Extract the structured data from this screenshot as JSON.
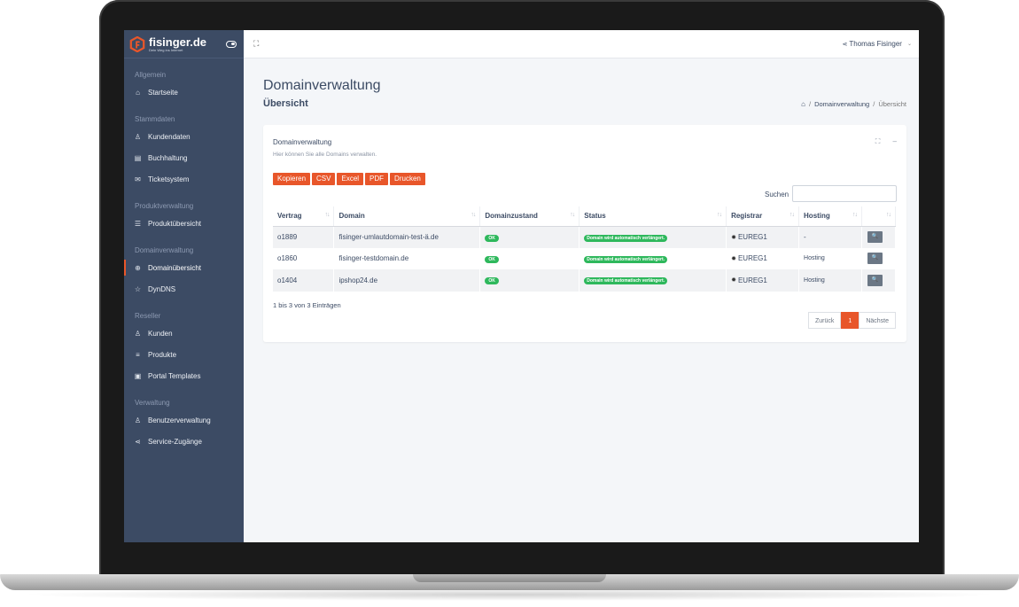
{
  "brand": {
    "name": "fisinger.de",
    "tagline": "Dein Weg ins Internet"
  },
  "sidebar": {
    "sections": [
      {
        "title": "Allgemein",
        "items": [
          {
            "label": "Startseite",
            "icon": "home-icon"
          }
        ]
      },
      {
        "title": "Stammdaten",
        "items": [
          {
            "label": "Kundendaten",
            "icon": "user-icon"
          },
          {
            "label": "Buchhaltung",
            "icon": "document-icon"
          },
          {
            "label": "Ticketsystem",
            "icon": "mail-icon"
          }
        ]
      },
      {
        "title": "Produktverwaltung",
        "items": [
          {
            "label": "Produktübersicht",
            "icon": "server-icon"
          }
        ]
      },
      {
        "title": "Domainverwaltung",
        "items": [
          {
            "label": "Domainübersicht",
            "icon": "globe-icon",
            "active": true
          },
          {
            "label": "DynDNS",
            "icon": "star-icon"
          }
        ]
      },
      {
        "title": "Reseller",
        "items": [
          {
            "label": "Kunden",
            "icon": "user-icon"
          },
          {
            "label": "Produkte",
            "icon": "list-icon"
          },
          {
            "label": "Portal Templates",
            "icon": "window-icon"
          }
        ]
      },
      {
        "title": "Verwaltung",
        "items": [
          {
            "label": "Benutzerverwaltung",
            "icon": "users-icon"
          },
          {
            "label": "Service-Zugänge",
            "icon": "share-icon"
          }
        ]
      }
    ]
  },
  "topbar": {
    "user": "Thomas Fisinger"
  },
  "page": {
    "title": "Domainverwaltung",
    "subtitle": "Übersicht",
    "breadcrumb": {
      "item1": "Domainverwaltung",
      "current": "Übersicht"
    }
  },
  "card": {
    "title": "Domainverwaltung",
    "description": "Hier können Sie alle Domains verwalten.",
    "buttons": {
      "copy": "Kopieren",
      "csv": "CSV",
      "excel": "Excel",
      "pdf": "PDF",
      "print": "Drucken"
    },
    "search_label": "Suchen",
    "columns": {
      "contract": "Vertrag",
      "domain": "Domain",
      "state": "Domainzustand",
      "status": "Status",
      "registrar": "Registrar",
      "hosting": "Hosting"
    },
    "rows": [
      {
        "contract": "o1889",
        "domain": "fisinger-umlautdomain-test-ä.de",
        "state": "OK",
        "status": "Domain wird automatisch verlängert.",
        "registrar": "EUREG1",
        "hosting": "-"
      },
      {
        "contract": "o1860",
        "domain": "fisinger-testdomain.de",
        "state": "OK",
        "status": "Domain wird automatisch verlängert.",
        "registrar": "EUREG1",
        "hosting": "Hosting"
      },
      {
        "contract": "o1404",
        "domain": "ipshop24.de",
        "state": "OK",
        "status": "Domain wird automatisch verlängert.",
        "registrar": "EUREG1",
        "hosting": "Hosting"
      }
    ],
    "entries_info": "1 bis 3 von 3 Einträgen",
    "pager": {
      "prev": "Zurück",
      "page": "1",
      "next": "Nächste"
    }
  },
  "colors": {
    "sidebar": "#3c4b64",
    "accent": "#e8562a",
    "success": "#2eb85c"
  }
}
